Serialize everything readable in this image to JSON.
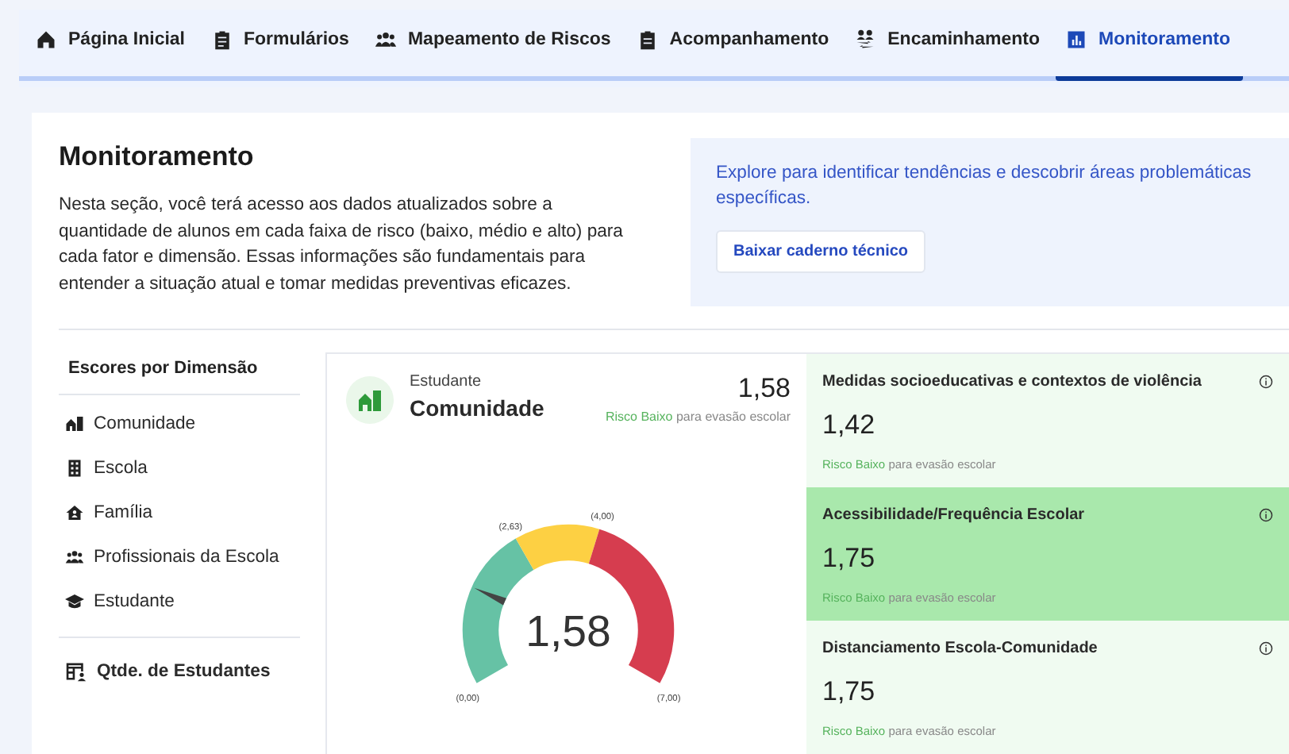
{
  "nav": {
    "tabs": [
      {
        "label": "Página Inicial",
        "selected": false
      },
      {
        "label": "Formulários",
        "selected": false
      },
      {
        "label": "Mapeamento de Riscos",
        "selected": false
      },
      {
        "label": "Acompanhamento",
        "selected": false
      },
      {
        "label": "Encaminhamento",
        "selected": false
      },
      {
        "label": "Monitoramento",
        "selected": true
      }
    ]
  },
  "intro": {
    "title": "Monitoramento",
    "text": "Nesta seção, você terá acesso aos dados atualizados sobre a quantidade de alunos em cada faixa de risco (baixo, médio e alto) para cada fator e dimensão. Essas informações são fundamentais para entender a situação atual e tomar medidas preventivas eficazes.",
    "info_text": "Explore para identificar tendências e descobrir áreas problemáticas específicas.",
    "button": "Baixar caderno técnico"
  },
  "sidebar": {
    "title": "Escores por Dimensão",
    "items": [
      {
        "label": "Comunidade"
      },
      {
        "label": "Escola"
      },
      {
        "label": "Família"
      },
      {
        "label": "Profissionais da Escola"
      },
      {
        "label": "Estudante"
      }
    ],
    "footer_item": "Qtde. de Estudantes"
  },
  "gauge_card": {
    "subtitle": "Estudante",
    "title": "Comunidade",
    "score": "1,58",
    "risk": "Risco Baixo",
    "risk_suffix": "para evasão escolar",
    "gauge": {
      "value": "1,58",
      "zones": [
        {
          "color": "#66c2a5"
        },
        {
          "color": "#fdd043"
        },
        {
          "color": "#d63d4f"
        }
      ],
      "ticks": [
        {
          "label": "(0,00)"
        },
        {
          "label": "(2,63)"
        },
        {
          "label": "(4,00)"
        },
        {
          "label": "(7,00)"
        }
      ]
    }
  },
  "factors": [
    {
      "title": "Medidas socioeducativas e contextos de violência",
      "score": "1,42",
      "risk": "Risco Baixo",
      "risk_suffix": "para evasão escolar",
      "selected": false
    },
    {
      "title": "Acessibilidade/Frequência Escolar",
      "score": "1,75",
      "risk": "Risco Baixo",
      "risk_suffix": "para evasão escolar",
      "selected": true
    },
    {
      "title": "Distanciamento Escola-Comunidade",
      "score": "1,75",
      "risk": "Risco Baixo",
      "risk_suffix": "para evasão escolar",
      "selected": false
    }
  ]
}
